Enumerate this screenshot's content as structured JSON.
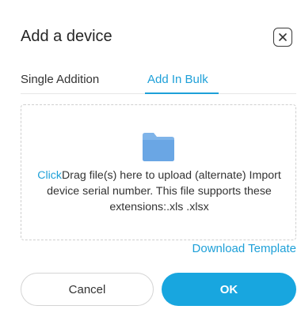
{
  "dialog": {
    "title": "Add a device",
    "close_icon": "close-icon"
  },
  "tabs": [
    {
      "label": "Single Addition",
      "active": false
    },
    {
      "label": "Add In Bulk",
      "active": true
    }
  ],
  "upload": {
    "icon": "folder-icon",
    "click_label": "Click",
    "instructions": "Drag file(s) here to upload (alternate) Import device serial number. This file supports these extensions:.xls .xlsx"
  },
  "download_template_label": "Download Template",
  "buttons": {
    "cancel_label": "Cancel",
    "ok_label": "OK"
  },
  "colors": {
    "accent": "#1ea0d8",
    "primary_button": "#18a6df"
  }
}
